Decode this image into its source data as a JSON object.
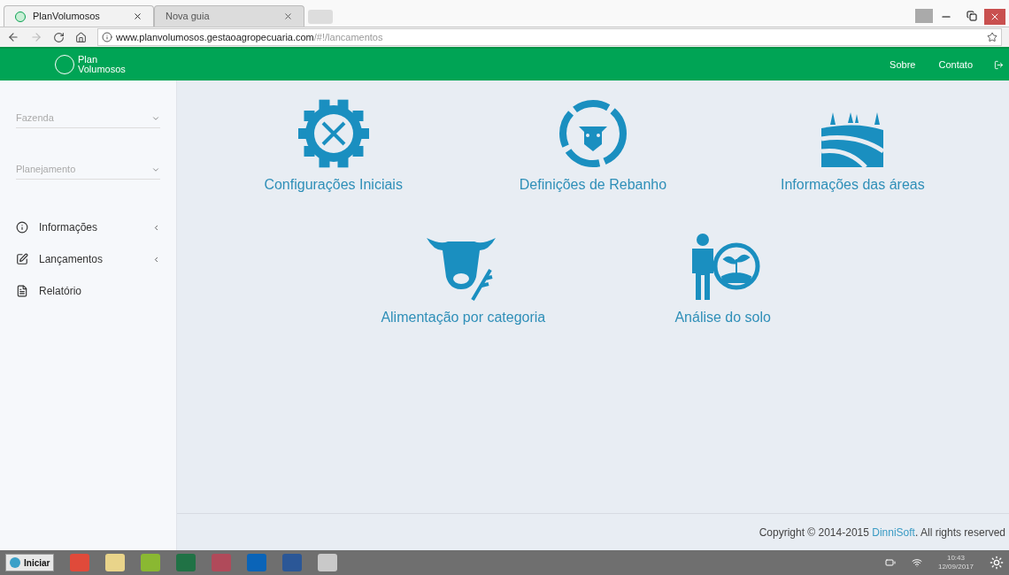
{
  "browser": {
    "tabs": [
      {
        "title": "PlanVolumosos",
        "selected": true
      },
      {
        "title": "Nova guia",
        "selected": false
      }
    ],
    "address": {
      "host": "www.planvolumosos.gestaoagropecuaria.com",
      "path": "/#!/lancamentos"
    }
  },
  "header": {
    "logo": [
      "Plan",
      "Volumosos"
    ],
    "links": [
      "Sobre",
      "Contato"
    ]
  },
  "sidebar": {
    "selects": [
      {
        "placeholder": "Fazenda"
      },
      {
        "placeholder": "Planejamento"
      }
    ],
    "items": [
      {
        "kind": "info",
        "label": "Informações",
        "expandable": true
      },
      {
        "kind": "edit",
        "label": "Lançamentos",
        "expandable": true
      },
      {
        "kind": "report",
        "label": "Relatório",
        "expandable": false
      }
    ]
  },
  "cards": [
    {
      "kind": "gear",
      "label": "Configurações Iniciais"
    },
    {
      "kind": "herd",
      "label": "Definições de Rebanho"
    },
    {
      "kind": "fields",
      "label": "Informações das áreas"
    },
    {
      "kind": "cow",
      "label": "Alimentação por categoria"
    },
    {
      "kind": "soil",
      "label": "Análise do solo"
    }
  ],
  "footer": {
    "prefix": "Copyright © 2014-2015 ",
    "link": "DinniSoft",
    "suffix": ". All rights reserved"
  },
  "taskbar": {
    "start": "Iniciar",
    "time": "10:43",
    "date": "12/09/2017"
  }
}
